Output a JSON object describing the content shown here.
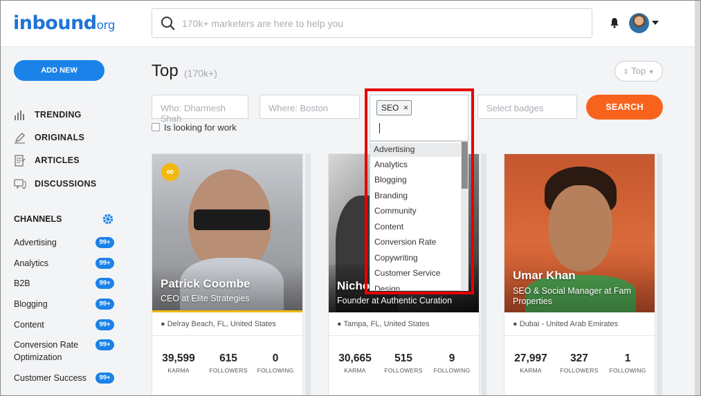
{
  "header": {
    "logo_main": "inbound",
    "logo_tld": "org",
    "search_placeholder": "170k+ marketers are here to help you"
  },
  "sidebar": {
    "add_new": "ADD NEW",
    "nav": [
      {
        "label": "TRENDING",
        "icon": "bar-chart-icon"
      },
      {
        "label": "ORIGINALS",
        "icon": "pen-icon"
      },
      {
        "label": "ARTICLES",
        "icon": "document-icon"
      },
      {
        "label": "DISCUSSIONS",
        "icon": "chat-icon"
      }
    ],
    "channels_title": "CHANNELS",
    "channels": [
      {
        "label": "Advertising",
        "badge": "99+"
      },
      {
        "label": "Analytics",
        "badge": "99+"
      },
      {
        "label": "B2B",
        "badge": "99+"
      },
      {
        "label": "Blogging",
        "badge": "99+"
      },
      {
        "label": "Content",
        "badge": "99+"
      },
      {
        "label": "Conversion Rate Optimization",
        "badge": "99+"
      },
      {
        "label": "Customer Success",
        "badge": "99+"
      }
    ]
  },
  "main": {
    "title": "Top",
    "count": "(170k+)",
    "sort_label": "Top",
    "filters": {
      "who_placeholder": "Who: Dharmesh Shah",
      "where_placeholder": "Where: Boston",
      "badges_placeholder": "Select badges",
      "search_button": "SEARCH",
      "looking_for_work": "Is looking for work"
    },
    "tag_selected": "SEO",
    "dropdown_options": [
      "Advertising",
      "Analytics",
      "Blogging",
      "Branding",
      "Community",
      "Content",
      "Conversion Rate",
      "Copywriting",
      "Customer Service",
      "Design"
    ],
    "cards": [
      {
        "name": "Patrick Coombe",
        "role": "CEO at Elite Strategies",
        "location": "Delray Beach, FL, United States",
        "karma": "39,599",
        "followers": "615",
        "following": "0"
      },
      {
        "name": "Nicho",
        "role": "Founder at Authentic Curation",
        "location": "Tampa, FL, United States",
        "karma": "30,665",
        "followers": "515",
        "following": "9"
      },
      {
        "name": "Umar Khan",
        "role": "SEO & Social Manager at Fam Properties",
        "location": "Dubai - United Arab Emirates",
        "karma": "27,997",
        "followers": "327",
        "following": "1"
      }
    ],
    "stat_labels": {
      "karma": "KARMA",
      "followers": "FOLLOWERS",
      "following": "FOLLOWING"
    }
  },
  "colors": {
    "brand_blue": "#1a82e8",
    "search_orange": "#f7631d",
    "highlight_red": "#e60000"
  }
}
